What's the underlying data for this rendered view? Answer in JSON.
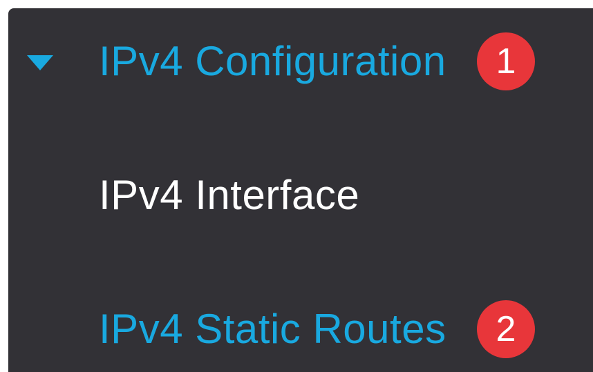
{
  "menu": {
    "section": {
      "label": "IPv4 Configuration",
      "expanded": true,
      "icon": "caret-down-icon",
      "badge": "1"
    },
    "items": [
      {
        "label": "IPv4 Interface"
      },
      {
        "label": "IPv4 Static Routes",
        "badge": "2"
      }
    ]
  },
  "colors": {
    "panel_background": "#323136",
    "accent_text": "#19a9e0",
    "plain_text": "#ffffff",
    "badge_background": "#e8363a"
  }
}
